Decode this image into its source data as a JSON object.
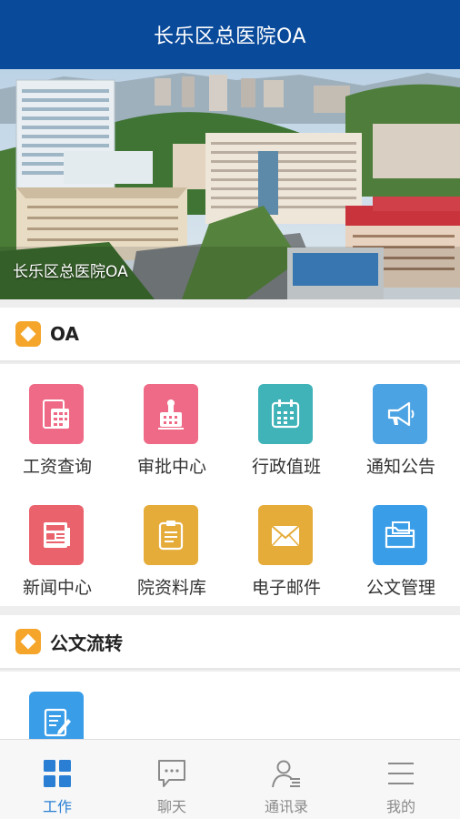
{
  "header": {
    "title": "长乐区总医院OA"
  },
  "banner": {
    "caption": "长乐区总医院OA"
  },
  "sections": [
    {
      "title": "OA",
      "tiles": [
        {
          "label": "工资查询",
          "icon": "salary-icon",
          "color": "#ef6a86"
        },
        {
          "label": "审批中心",
          "icon": "stamp-icon",
          "color": "#ef6a86"
        },
        {
          "label": "行政值班",
          "icon": "calendar-icon",
          "color": "#3fb3b8"
        },
        {
          "label": "通知公告",
          "icon": "megaphone-icon",
          "color": "#4ca3e3"
        },
        {
          "label": "新闻中心",
          "icon": "newspaper-icon",
          "color": "#e9626c"
        },
        {
          "label": "院资料库",
          "icon": "clipboard-icon",
          "color": "#e5ac3a"
        },
        {
          "label": "电子邮件",
          "icon": "envelope-icon",
          "color": "#e5ac3a"
        },
        {
          "label": "公文管理",
          "icon": "folder-icon",
          "color": "#3a9de8"
        }
      ]
    },
    {
      "title": "公文流转",
      "tiles": [
        {
          "label": "",
          "icon": "document-edit-icon",
          "color": "#3a9de8"
        }
      ]
    }
  ],
  "tabbar": {
    "items": [
      {
        "label": "工作",
        "icon": "grid-icon",
        "active": true
      },
      {
        "label": "聊天",
        "icon": "chat-icon",
        "active": false
      },
      {
        "label": "通讯录",
        "icon": "contacts-icon",
        "active": false
      },
      {
        "label": "我的",
        "icon": "menu-icon",
        "active": false
      }
    ],
    "active_color": "#2a7fd4",
    "inactive_color": "#8a8a8a"
  }
}
